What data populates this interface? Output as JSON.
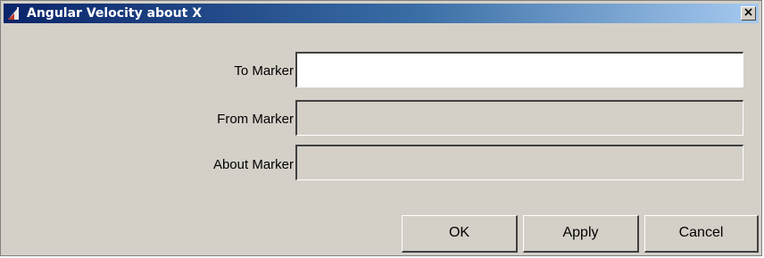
{
  "window": {
    "title": "Angular Velocity about X",
    "close_label": "×",
    "icon": "app-logo-icon"
  },
  "form": {
    "fields": [
      {
        "label": "To Marker",
        "value": "",
        "enabled": true
      },
      {
        "label": "From Marker",
        "value": "",
        "enabled": false
      },
      {
        "label": "About Marker",
        "value": "",
        "enabled": false
      }
    ]
  },
  "buttons": {
    "ok": "OK",
    "apply": "Apply",
    "cancel": "Cancel"
  },
  "colors": {
    "face": "#d4d0c8",
    "title_start": "#0a246a",
    "title_end": "#a6caf0"
  }
}
